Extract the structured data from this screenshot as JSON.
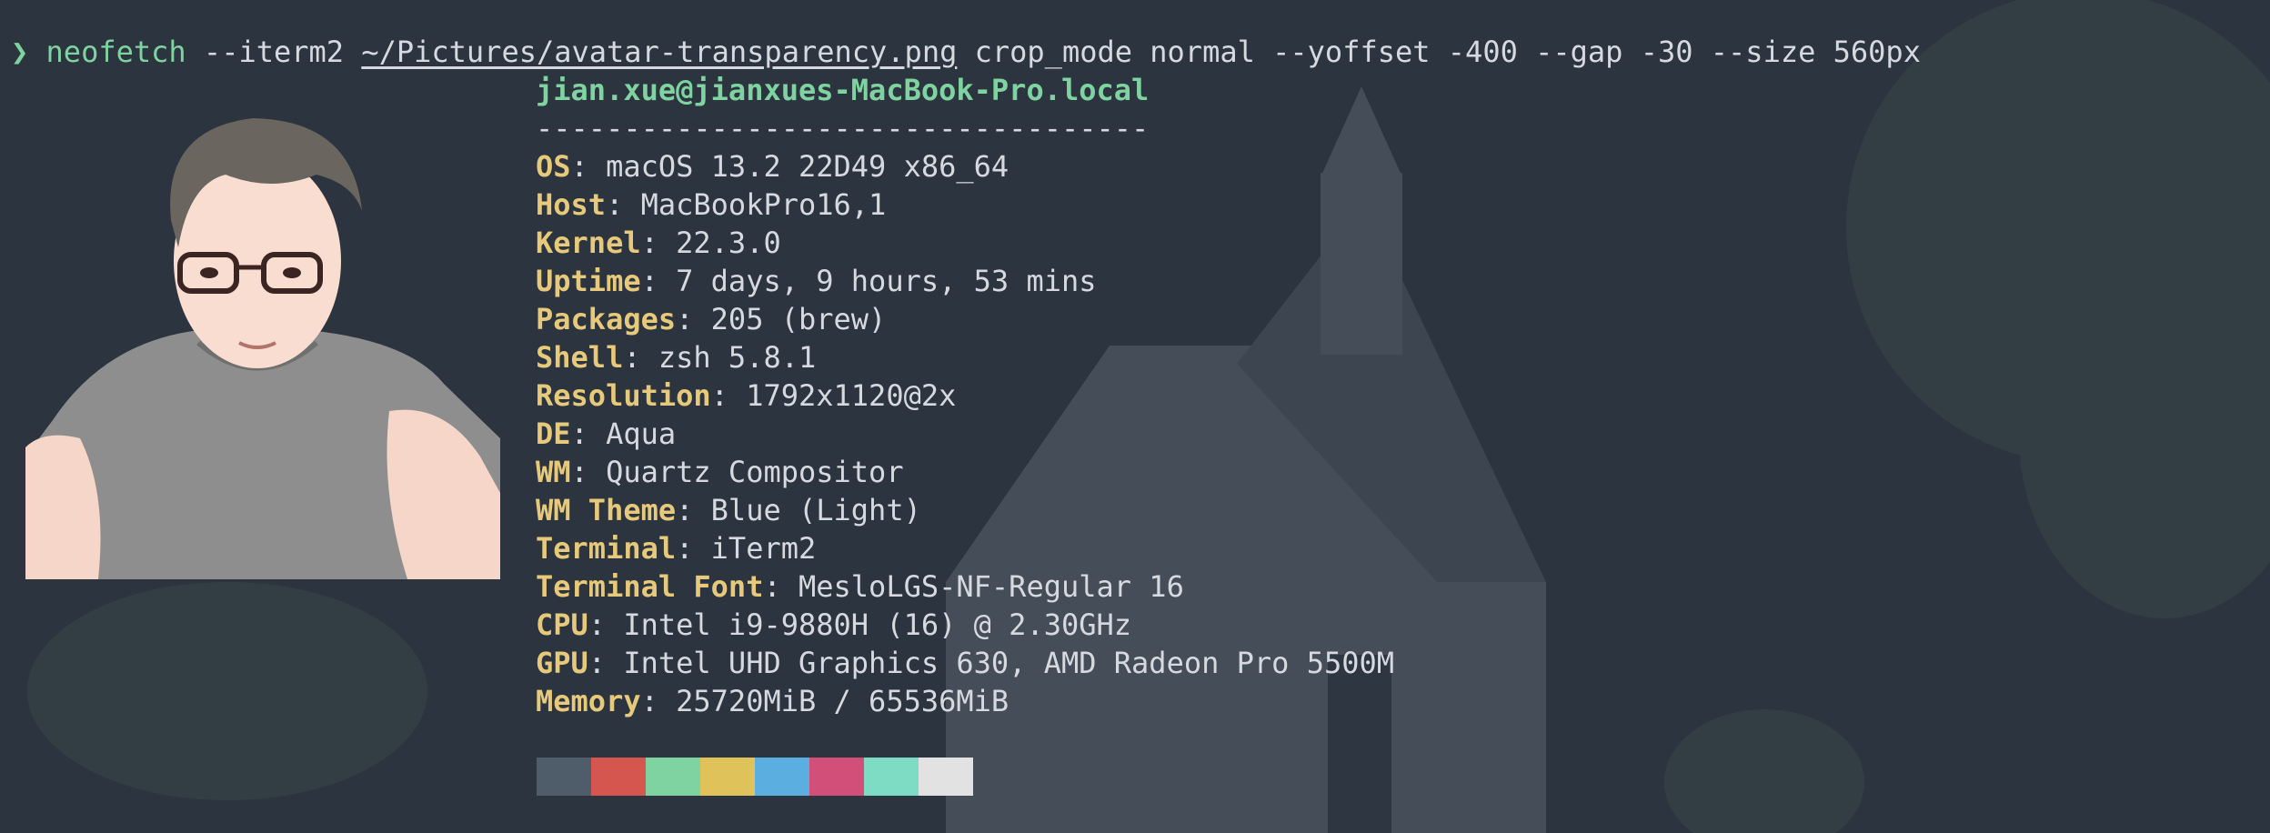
{
  "command": {
    "prompt_symbol": "❯",
    "program": "neofetch",
    "args_before": "--iterm2",
    "image_path": "~/Pictures/avatar-transparency.png",
    "args_after": "crop_mode normal --yoffset -400 --gap -30 --size 560px"
  },
  "header": {
    "user_host": "jian.xue@jianxues-MacBook-Pro.local",
    "separator": "-----------------------------------"
  },
  "info": [
    {
      "key": "OS",
      "value": "macOS 13.2 22D49 x86_64"
    },
    {
      "key": "Host",
      "value": "MacBookPro16,1"
    },
    {
      "key": "Kernel",
      "value": "22.3.0"
    },
    {
      "key": "Uptime",
      "value": "7 days, 9 hours, 53 mins"
    },
    {
      "key": "Packages",
      "value": "205 (brew)"
    },
    {
      "key": "Shell",
      "value": "zsh 5.8.1"
    },
    {
      "key": "Resolution",
      "value": "1792x1120@2x"
    },
    {
      "key": "DE",
      "value": "Aqua"
    },
    {
      "key": "WM",
      "value": "Quartz Compositor"
    },
    {
      "key": "WM Theme",
      "value": "Blue (Light)"
    },
    {
      "key": "Terminal",
      "value": "iTerm2"
    },
    {
      "key": "Terminal Font",
      "value": "MesloLGS-NF-Regular 16"
    },
    {
      "key": "CPU",
      "value": "Intel i9-9880H (16) @ 2.30GHz"
    },
    {
      "key": "GPU",
      "value": "Intel UHD Graphics 630, AMD Radeon Pro 5500M"
    },
    {
      "key": "Memory",
      "value": "25720MiB / 65536MiB"
    }
  ],
  "colors": {
    "background": "#2c3440",
    "accent_green": "#7fd3a0",
    "key_yellow": "#e6c97a",
    "text": "#d6dae0",
    "palette": [
      "#4f5d6b",
      "#d4564e",
      "#7fd3a0",
      "#dfc25a",
      "#5aafe0",
      "#d24f7a",
      "#7fdcc4",
      "#e2e2e2"
    ]
  }
}
